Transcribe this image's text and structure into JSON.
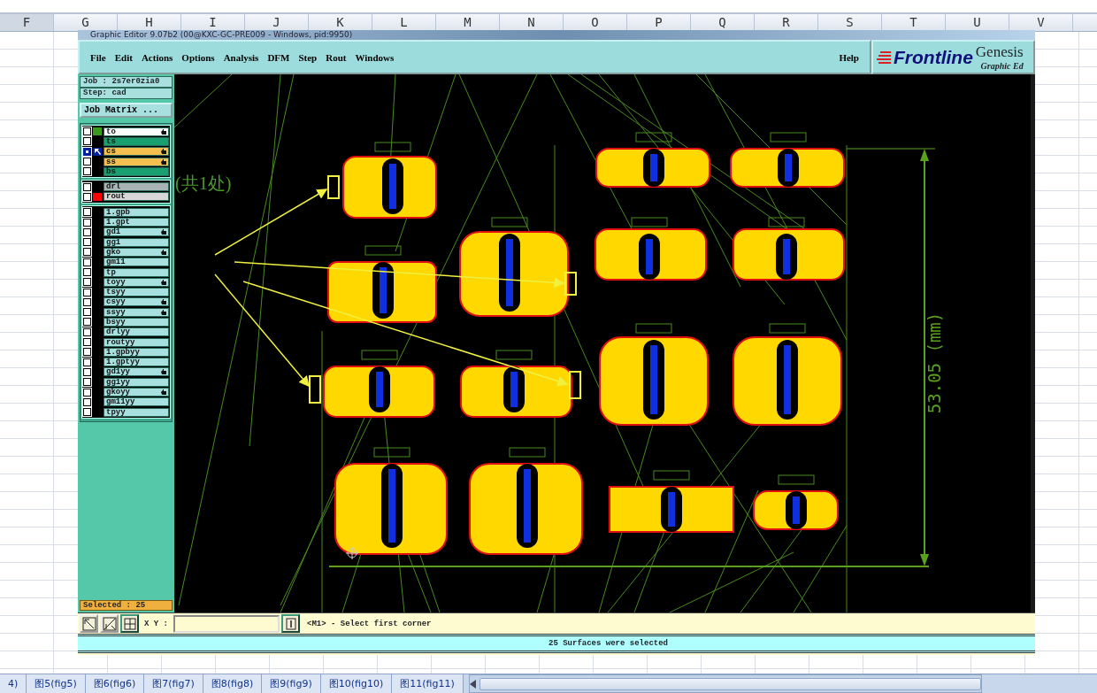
{
  "excel": {
    "columns": [
      "F",
      "G",
      "H",
      "I",
      "J",
      "K",
      "L",
      "M",
      "N",
      "O",
      "P",
      "Q",
      "R",
      "S",
      "T",
      "U",
      "V"
    ],
    "sheet_tabs": [
      {
        "label": "4)",
        "selected": false
      },
      {
        "label": "图5(fig5)",
        "selected": false
      },
      {
        "label": "图6(fig6)",
        "selected": false
      },
      {
        "label": "图7(fig7)",
        "selected": false
      },
      {
        "label": "图8(fig8)",
        "selected": false
      },
      {
        "label": "图9(fig9)",
        "selected": false
      },
      {
        "label": "图10(fig10)",
        "selected": false
      },
      {
        "label": "图11(fig11)",
        "selected": false
      }
    ]
  },
  "window": {
    "title": "Graphic Editor 9.07b2 (00@KXC-GC-PRE009 - Windows, pid:9950)",
    "menu": [
      "File",
      "Edit",
      "Actions",
      "Options",
      "Analysis",
      "DFM",
      "Step",
      "Rout",
      "Windows"
    ],
    "help": "Help",
    "logo": {
      "brand": "Frontline",
      "product": "Genesis",
      "subtitle": "Graphic Ed"
    }
  },
  "sidebar": {
    "job": "Job : 2s7er0zia0",
    "step": "Step: cad",
    "job_matrix": "Job Matrix ...",
    "layer_groups": [
      [
        {
          "name": "to",
          "kind": "silk",
          "color": "#3a9a1a",
          "flag": true,
          "work_layer": false
        },
        {
          "name": "ts",
          "kind": "mask",
          "flag": false,
          "work_layer": false
        },
        {
          "name": "cs",
          "kind": "signal",
          "flag": true,
          "work_layer": true
        },
        {
          "name": "ss",
          "kind": "signal",
          "flag": true,
          "work_layer": false
        },
        {
          "name": "bs",
          "kind": "mask",
          "flag": false,
          "work_layer": false
        }
      ],
      [
        {
          "name": "drl",
          "kind": "drill",
          "flag": false,
          "work_layer": false
        },
        {
          "name": "rout",
          "kind": "rout",
          "color": "#ff0000",
          "flag": false,
          "work_layer": false
        }
      ],
      [
        {
          "name": "1.gpb",
          "kind": "misc",
          "flag": false,
          "work_layer": false
        },
        {
          "name": "1.gpt",
          "kind": "misc",
          "flag": false,
          "work_layer": false
        },
        {
          "name": "gd1",
          "kind": "misc",
          "flag": true,
          "work_layer": false
        },
        {
          "name": "gg1",
          "kind": "misc",
          "flag": false,
          "work_layer": false
        },
        {
          "name": "gko",
          "kind": "misc",
          "flag": true,
          "work_layer": false
        },
        {
          "name": "gm11",
          "kind": "misc",
          "flag": false,
          "work_layer": false
        },
        {
          "name": "tp",
          "kind": "misc",
          "flag": false,
          "work_layer": false
        },
        {
          "name": "toyy",
          "kind": "misc",
          "flag": true,
          "work_layer": false
        },
        {
          "name": "tsyy",
          "kind": "misc",
          "flag": false,
          "work_layer": false
        },
        {
          "name": "csyy",
          "kind": "misc",
          "flag": true,
          "work_layer": false
        },
        {
          "name": "ssyy",
          "kind": "misc",
          "flag": true,
          "work_layer": false
        },
        {
          "name": "bsyy",
          "kind": "misc",
          "flag": false,
          "work_layer": false
        },
        {
          "name": "drlyy",
          "kind": "misc",
          "flag": false,
          "work_layer": false
        },
        {
          "name": "routyy",
          "kind": "misc",
          "flag": false,
          "work_layer": false
        },
        {
          "name": "1.gpbyy",
          "kind": "misc",
          "flag": false,
          "work_layer": false
        },
        {
          "name": "1.gptyy",
          "kind": "misc",
          "flag": false,
          "work_layer": false
        },
        {
          "name": "gd1yy",
          "kind": "misc",
          "flag": true,
          "work_layer": false
        },
        {
          "name": "gg1yy",
          "kind": "misc",
          "flag": false,
          "work_layer": false
        },
        {
          "name": "gkoyy",
          "kind": "misc",
          "flag": true,
          "work_layer": false
        },
        {
          "name": "gm11yy",
          "kind": "misc",
          "flag": false,
          "work_layer": false
        },
        {
          "name": "tpyy",
          "kind": "misc",
          "flag": false,
          "work_layer": false
        }
      ]
    ],
    "selected_count": "Selected : 25"
  },
  "canvas": {
    "annotation": "(共1处)",
    "dimension": "53.05 (mm)"
  },
  "command_bar": {
    "xy_label": "X Y :",
    "prompt": "<M1> - Select first corner"
  },
  "status_bar": "25 Surfaces were selected"
}
